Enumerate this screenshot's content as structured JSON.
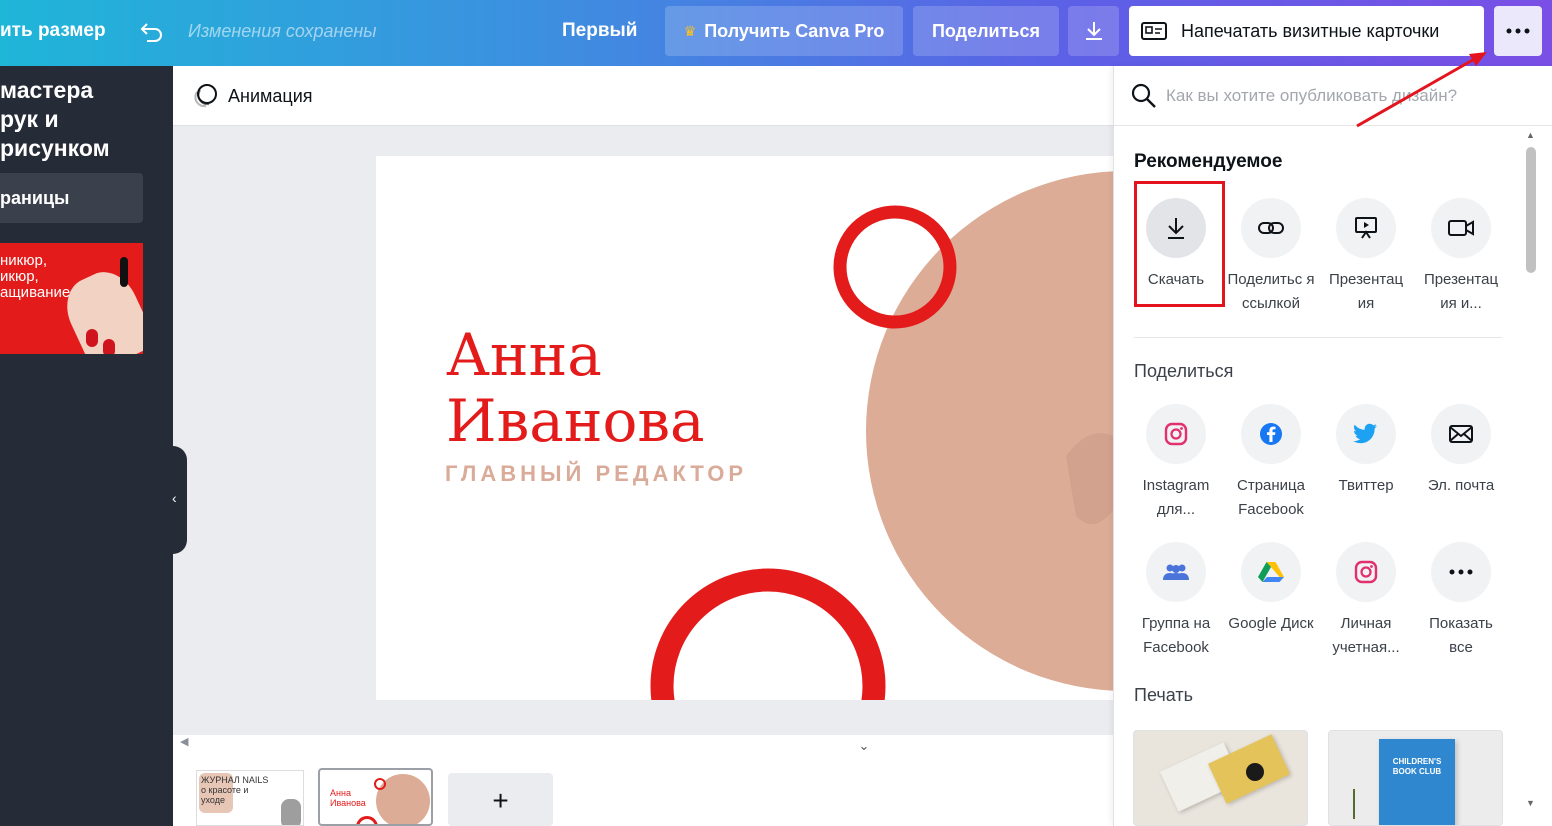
{
  "topbar": {
    "resize_label": "ить размер",
    "saved_status": "Изменения сохранены",
    "design_title": "Первый",
    "pro_label": "Получить Canva Pro",
    "share_label": "Поделиться",
    "print_label": "Напечатать визитные карточки",
    "icons": [
      "undo-icon",
      "crown-icon",
      "download-icon",
      "business-card-icon",
      "more-icon"
    ]
  },
  "left_panel": {
    "title": "мастера\nрук и\nрисунком",
    "pages_label": "раницы",
    "thumb_text": "никюр,\nикюр,\nащивание"
  },
  "canvas": {
    "animation_label": "Анимация",
    "card_name": "Анна\nИванова",
    "card_role": "ГЛАВНЫЙ РЕДАКТОР",
    "thumb1_text": "ЖУРНАЛ NAILS\nо красоте и\nуходе",
    "thumb2_text": "Анна\nИванова",
    "add_page": "+"
  },
  "publish_menu": {
    "search_placeholder": "Как вы хотите опубликовать дизайн?",
    "recommended_title": "Рекомендуемое",
    "recommended": [
      {
        "label": "Скачать",
        "icon": "download-icon"
      },
      {
        "label": "Поделитьс я ссылкой",
        "icon": "link-icon"
      },
      {
        "label": "Презентац ия",
        "icon": "present-icon"
      },
      {
        "label": "Презентац ия и...",
        "icon": "video-icon"
      }
    ],
    "share_title": "Поделиться",
    "share": [
      {
        "label": "Instagram для...",
        "icon": "instagram-icon"
      },
      {
        "label": "Страница Facebook",
        "icon": "facebook-icon"
      },
      {
        "label": "Твиттер",
        "icon": "twitter-icon"
      },
      {
        "label": "Эл. почта",
        "icon": "email-icon"
      },
      {
        "label": "Группа на Facebook",
        "icon": "facebook-group-icon"
      },
      {
        "label": "Google Диск",
        "icon": "google-drive-icon"
      },
      {
        "label": "Личная учетная...",
        "icon": "instagram-icon"
      },
      {
        "label": "Показать все",
        "icon": "more-icon"
      }
    ],
    "print_title": "Печать",
    "print_card_2_title": "CHILDREN'S BOOK CLUB"
  },
  "colors": {
    "accent_red": "#e31b1b",
    "card_peach": "#dcac96",
    "highlight": "#e3141e"
  }
}
